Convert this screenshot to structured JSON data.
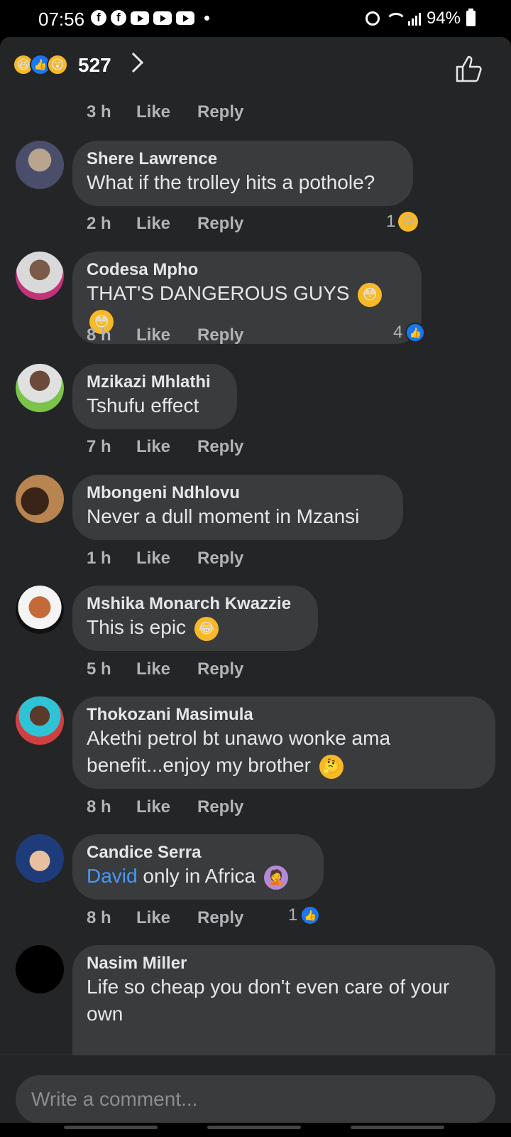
{
  "status_bar": {
    "time": "07:56",
    "battery": "94%",
    "fb_glyph": "f"
  },
  "header": {
    "reaction_count": "527",
    "reactions": [
      "haha",
      "like",
      "wow"
    ]
  },
  "first_meta": {
    "time": "3 h",
    "like": "Like",
    "reply": "Reply"
  },
  "comments": [
    {
      "author": "Shere Lawrence",
      "text": "What if the trolley hits a pothole?",
      "time": "2 h",
      "like": "Like",
      "reply": "Reply",
      "reaction_count": "1",
      "reaction": "sad"
    },
    {
      "author": "Codesa Mpho",
      "text": "THAT'S DANGEROUS GUYS",
      "time": "8 h",
      "like": "Like",
      "reply": "Reply",
      "reaction_count": "4",
      "reaction": "like"
    },
    {
      "author": "Mzikazi Mhlathi",
      "text": "Tshufu effect",
      "time": "7 h",
      "like": "Like",
      "reply": "Reply"
    },
    {
      "author": "Mbongeni Ndhlovu",
      "text": "Never a dull moment in Mzansi",
      "time": "1 h",
      "like": "Like",
      "reply": "Reply"
    },
    {
      "author": "Mshika Monarch Kwazzie",
      "text": "This is epic",
      "time": "5 h",
      "like": "Like",
      "reply": "Reply"
    },
    {
      "author": "Thokozani Masimula",
      "text_line1": "Akethi petrol bt unawo wonke ama",
      "text_line2": "benefit...enjoy my brother",
      "time": "8 h",
      "like": "Like",
      "reply": "Reply"
    },
    {
      "author": "Candice Serra",
      "mention": "David",
      "text": " only in Africa",
      "time": "8 h",
      "like": "Like",
      "reply": "Reply",
      "reaction_count": "1",
      "reaction": "like"
    },
    {
      "author": "Nasim Miller",
      "text_line1": "Life so cheap you don't even care of your",
      "text_line2": "own"
    }
  ],
  "composer": {
    "placeholder": "Write a comment..."
  },
  "colors": {
    "panel": "#242526",
    "bubble": "#3a3b3c",
    "accent": "#1877f2",
    "mention": "#4599ff"
  }
}
